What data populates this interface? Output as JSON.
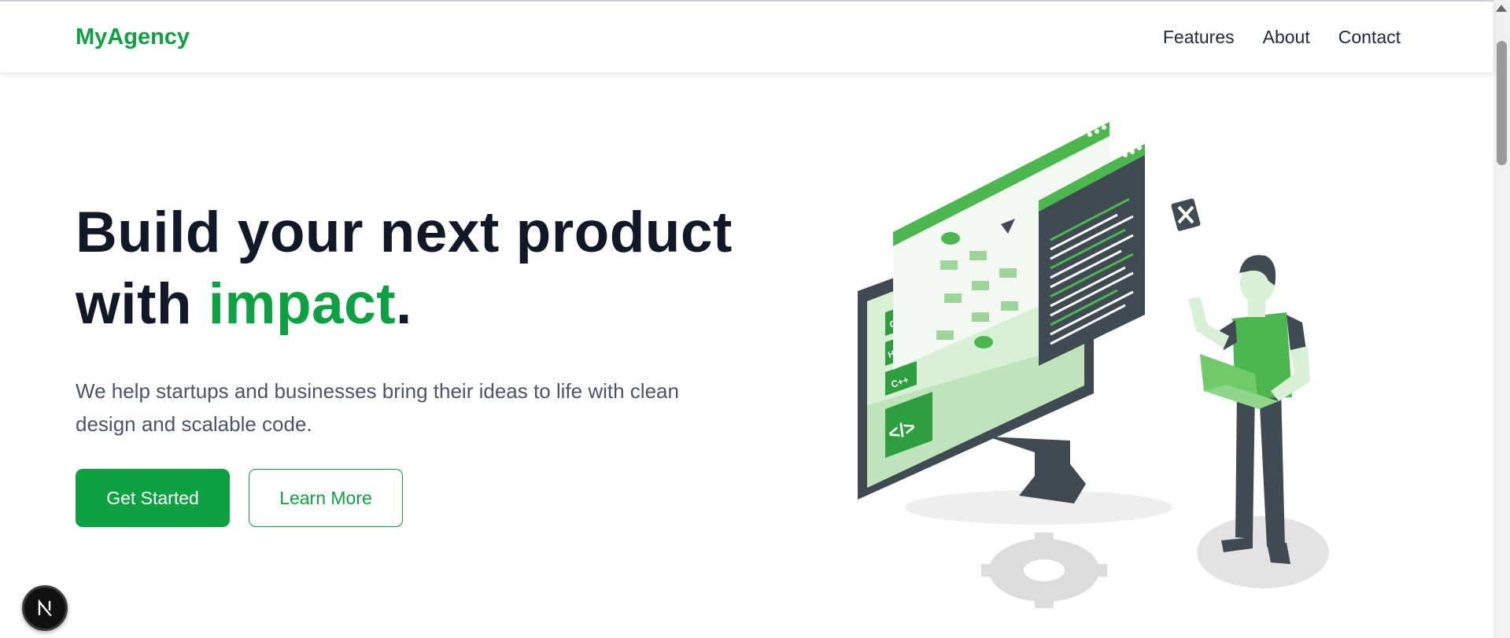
{
  "nav": {
    "brand": "MyAgency",
    "links": [
      "Features",
      "About",
      "Contact"
    ]
  },
  "hero": {
    "headline_line1": "Build your next product",
    "headline_with": "with ",
    "headline_accent": "impact",
    "headline_end": ".",
    "subtitle": "We help startups and businesses bring their ideas to life with clean design and scalable code.",
    "primary_button": "Get Started",
    "secondary_button": "Learn More"
  },
  "illustration": {
    "code_tags": [
      "CSS",
      "HTML",
      "C++",
      "</>"
    ]
  },
  "colors": {
    "accent": "#0ea142",
    "heading": "#111827",
    "body_text": "#4b5563",
    "illustration_dark": "#3f4a52"
  },
  "icons": {
    "next_badge": "next-js-icon",
    "scroll_up": "triangle-up-icon"
  }
}
